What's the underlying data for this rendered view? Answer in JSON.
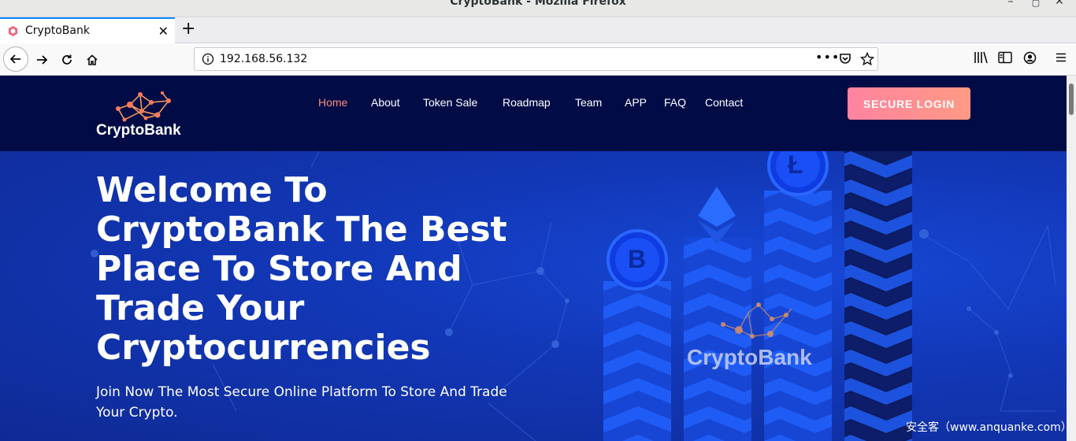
{
  "window": {
    "title": "CryptoBank - Mozilla Firefox"
  },
  "tab": {
    "label": "CryptoBank"
  },
  "urlbar": {
    "url": "192.168.56.132"
  },
  "site": {
    "logo_text": "CryptoBank",
    "menu": [
      "Home",
      "About",
      "Token Sale",
      "Roadmap",
      "Team",
      "APP",
      "FAQ",
      "Contact"
    ],
    "active_menu": "Home",
    "login_label": "SECURE LOGIN"
  },
  "hero": {
    "title": "Welcome To CryptoBank The Best Place To Store And Trade Your Cryptocurrencies",
    "subtitle": "Join Now The Most Secure Online Platform To Store And Trade Your Crypto.",
    "art_text": "CryptoBank",
    "btc_symbol": "B",
    "ltc_symbol": "Ł"
  },
  "watermark": "安全客（www.anquanke.com）",
  "colors": {
    "header_bg": "#010c46",
    "hero_bg": "#1238b8",
    "accent": "#ff8b7c",
    "login_gradient_start": "#ff83a0",
    "login_gradient_end": "#ff9a84"
  }
}
